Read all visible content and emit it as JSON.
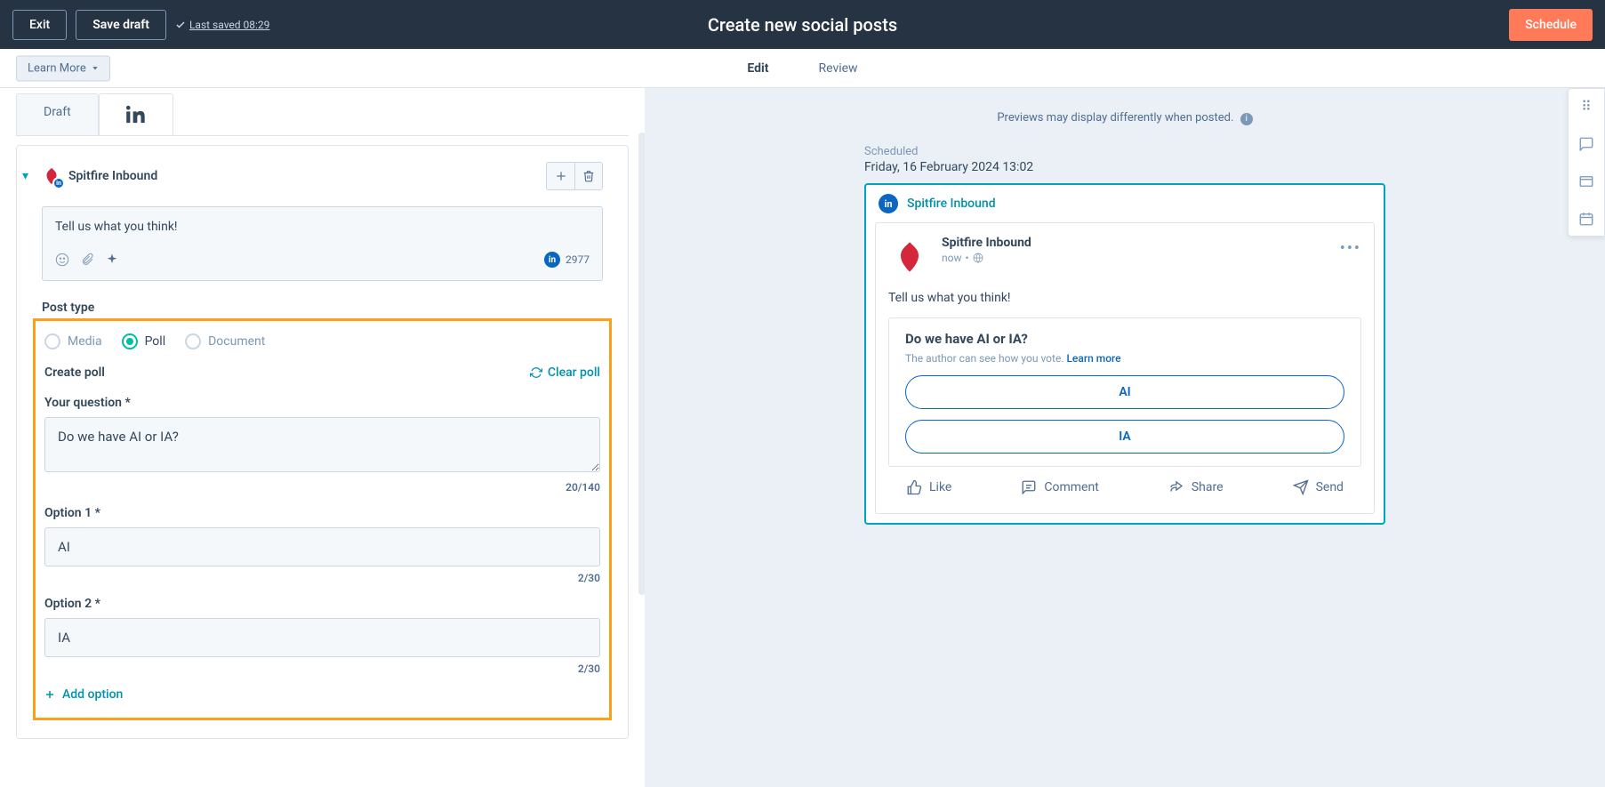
{
  "topbar": {
    "exit": "Exit",
    "save_draft": "Save draft",
    "last_saved": "Last saved 08:29",
    "title": "Create new social posts",
    "schedule": "Schedule"
  },
  "subbar": {
    "learn_more": "Learn More",
    "tabs": {
      "edit": "Edit",
      "review": "Review"
    }
  },
  "left": {
    "tabs": {
      "draft": "Draft"
    },
    "account": "Spitfire Inbound",
    "composer_text": "Tell us what you think!",
    "char_remaining": "2977",
    "post_type_label": "Post type",
    "post_types": {
      "media": "Media",
      "poll": "Poll",
      "document": "Document"
    },
    "create_poll_label": "Create poll",
    "clear_poll": "Clear poll",
    "question_label": "Your question",
    "question_value": "Do we have AI or IA?",
    "question_counter": "20/140",
    "option1_label": "Option 1",
    "option1_value": "AI",
    "option1_counter": "2/30",
    "option2_label": "Option 2",
    "option2_value": "IA",
    "option2_counter": "2/30",
    "add_option": "Add option"
  },
  "right": {
    "preview_note": "Previews may display differently when posted.",
    "scheduled_label": "Scheduled",
    "scheduled_time": "Friday, 16 February 2024 13:02",
    "preview_account": "Spitfire Inbound",
    "card_account": "Spitfire Inbound",
    "card_time": "now",
    "card_text": "Tell us what you think!",
    "poll_question": "Do we have AI or IA?",
    "poll_note_prefix": "The author can see how you vote. ",
    "poll_note_link": "Learn more",
    "poll_options": [
      "AI",
      "IA"
    ],
    "actions": {
      "like": "Like",
      "comment": "Comment",
      "share": "Share",
      "send": "Send"
    }
  }
}
